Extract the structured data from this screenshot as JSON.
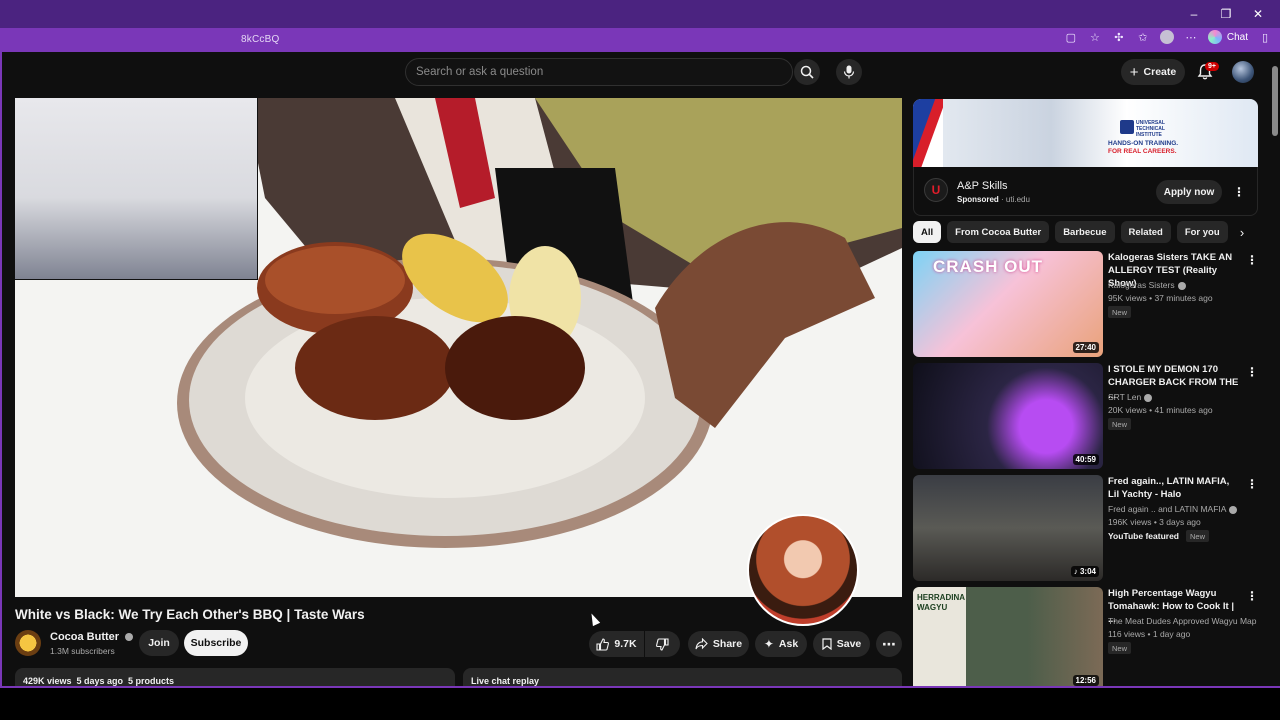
{
  "browser": {
    "url_fragment": "8kCcBQ",
    "chat_label": "Chat",
    "window_controls": [
      "–",
      "❐",
      "✕"
    ]
  },
  "header": {
    "search_placeholder": "Search or ask a question",
    "create_label": "Create",
    "notification_count": "9+"
  },
  "video": {
    "title": "White vs Black: We Try Each Other's BBQ | Taste Wars",
    "channel_name": "Cocoa Butter",
    "subscribers": "1.3M subscribers",
    "join_label": "Join",
    "subscribe_label": "Subscribe",
    "likes": "9.7K",
    "share_label": "Share",
    "ask_label": "Ask",
    "save_label": "Save",
    "description_summary": "429K views  5 days ago  5 products",
    "chat_replay_label": "Live chat replay"
  },
  "ad": {
    "banner_tag": "UNIVERSAL TECHNICAL INSTITUTE",
    "banner_line1": "HANDS-ON TRAINING.",
    "banner_line2": "FOR REAL CAREERS.",
    "title": "A&P Skills",
    "sponsored_label": "Sponsored",
    "domain": "uti.edu",
    "cta": "Apply now"
  },
  "chips": [
    "All",
    "From Cocoa Butter",
    "Barbecue",
    "Related",
    "For you"
  ],
  "recommendations": [
    {
      "title": "Kalogeras Sisters TAKE AN ALLERGY TEST (Reality Show)",
      "channel": "Kalogeras Sisters",
      "verified": true,
      "meta": "95K views • 37 minutes ago",
      "badge": "New",
      "duration": "27:40",
      "thumb_text": "CRASH OUT"
    },
    {
      "title": "I STOLE MY DEMON 170 CHARGER BACK FROM THE ...",
      "channel": "SRT Len",
      "verified": true,
      "meta": "20K views • 41 minutes ago",
      "badge": "New",
      "duration": "40:59"
    },
    {
      "title": "Fred again.., LATIN MAFIA, Lil Yachty - Halo",
      "channel": "Fred again .. and LATIN MAFIA",
      "verified": true,
      "meta": "196K views • 3 days ago",
      "featured": "YouTube featured",
      "badge": "New",
      "duration": "3:04"
    },
    {
      "title": "High Percentage Wagyu Tomahawk: How to Cook It | ...",
      "channel": "The Meat Dudes Approved Wagyu Map",
      "meta": "116 views • 1 day ago",
      "badge": "New",
      "duration": "12:56",
      "thumb_text": "HERRADINA WAGYU"
    }
  ]
}
